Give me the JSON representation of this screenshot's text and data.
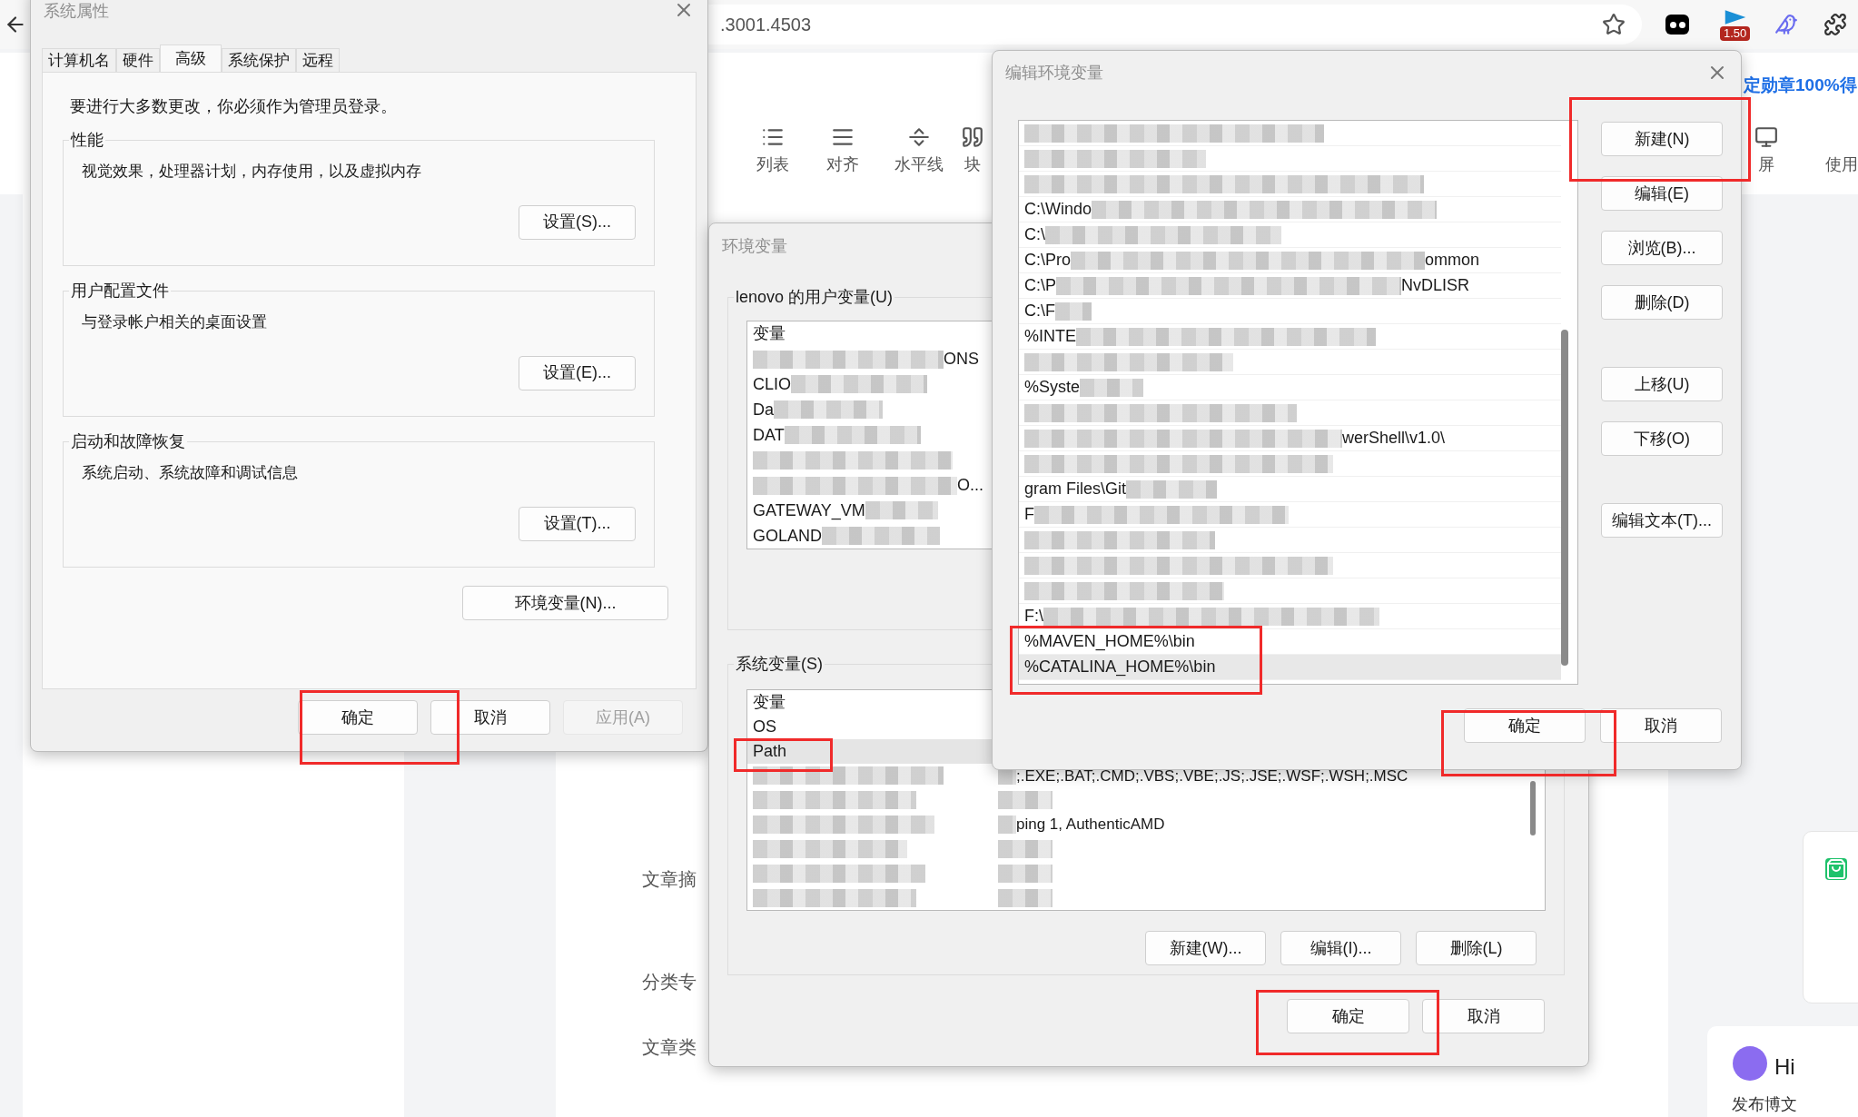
{
  "browser": {
    "address": ".3001.4503",
    "extension_badge": "1.50",
    "banner": "定勋章100%得"
  },
  "editor_toolbar": [
    {
      "label": "列表",
      "kind": "list"
    },
    {
      "label": "对齐",
      "kind": "align"
    },
    {
      "label": "水平线",
      "kind": "rule"
    },
    {
      "label": "块",
      "kind": "quote"
    },
    {
      "label": "屏",
      "kind": "screen"
    },
    {
      "label": "使用",
      "kind": "plain"
    }
  ],
  "form_labels": [
    "文章摘",
    "分类专",
    "文章类"
  ],
  "assistant": {
    "greeting": "Hi",
    "action": "发布博文"
  },
  "system_properties": {
    "title": "系统属性",
    "tabs": [
      {
        "label": "计算机名",
        "selected": false
      },
      {
        "label": "硬件",
        "selected": false
      },
      {
        "label": "高级",
        "selected": true
      },
      {
        "label": "系统保护",
        "selected": false
      },
      {
        "label": "远程",
        "selected": false
      }
    ],
    "notice": "要进行大多数更改，你必须作为管理员登录。",
    "groups": [
      {
        "title": "性能",
        "description": "视觉效果，处理器计划，内存使用，以及虚拟内存",
        "button": "设置(S)..."
      },
      {
        "title": "用户配置文件",
        "description": "与登录帐户相关的桌面设置",
        "button": "设置(E)..."
      },
      {
        "title": "启动和故障恢复",
        "description": "系统启动、系统故障和调试信息",
        "button": "设置(T)..."
      }
    ],
    "env_button": "环境变量(N)...",
    "buttons": [
      {
        "label": "确定",
        "disabled": false
      },
      {
        "label": "取消",
        "disabled": false
      },
      {
        "label": "应用(A)",
        "disabled": true
      }
    ]
  },
  "environment_variables": {
    "title": "环境变量",
    "user_group": "lenovo 的用户变量(U)",
    "user_header": "变量",
    "user_rows": [
      {
        "end": "ONS",
        "blurred": true
      },
      {
        "start": "CLIO",
        "blurred": true
      },
      {
        "start": "Da",
        "blurred": true
      },
      {
        "start": "DAT",
        "blurred": true
      },
      {
        "blurred": true
      },
      {
        "end": "O...",
        "blurred": true
      },
      {
        "start": "GATEWAY_VM",
        "blurred": true
      },
      {
        "start": "GOLAND",
        "blurred": true
      }
    ],
    "system_group": "系统变量(S)",
    "system_header": "变量",
    "system_rows": [
      {
        "name": "OS",
        "blurred": false,
        "selected": false
      },
      {
        "name": "Path",
        "blurred": false,
        "selected": true
      },
      {
        "value": ";.EXE;.BAT;.CMD;.VBS;.VBE;.JS;.JSE;.WSF;.WSH;.MSC",
        "blurred": true,
        "selected": false
      },
      {
        "blurred": true,
        "selected": false
      },
      {
        "value": "ping 1, AuthenticAMD",
        "blurred": true,
        "selected": false
      },
      {
        "blurred": true,
        "selected": false
      },
      {
        "blurred": true,
        "selected": false
      },
      {
        "blurred": true,
        "selected": false
      }
    ],
    "list_buttons": [
      "新建(W)...",
      "编辑(I)...",
      "删除(L)"
    ],
    "buttons": [
      "确定",
      "取消"
    ]
  },
  "edit_variable": {
    "title": "编辑环境变量",
    "rows": [
      {
        "blurred": true,
        "selected": false
      },
      {
        "blurred": true,
        "selected": false
      },
      {
        "blurred": true,
        "selected": false
      },
      {
        "start": "C:\\Windo",
        "blurred": true,
        "selected": false
      },
      {
        "start": "C:\\",
        "blurred": true,
        "selected": false
      },
      {
        "start": "C:\\Pro",
        "end": "ommon",
        "blurred": true,
        "selected": false
      },
      {
        "start": "C:\\P",
        "end": "NvDLISR",
        "blurred": true,
        "selected": false
      },
      {
        "start": "C:\\F",
        "blurred": true,
        "selected": false
      },
      {
        "start": "%INTE",
        "blurred": true,
        "selected": false
      },
      {
        "blurred": true,
        "selected": false
      },
      {
        "start": "%Syste",
        "blurred": true,
        "selected": false
      },
      {
        "blurred": true,
        "selected": false
      },
      {
        "end": "werShell\\v1.0\\",
        "blurred": true,
        "selected": false
      },
      {
        "blurred": true,
        "selected": false
      },
      {
        "start": "gram Files\\Git",
        "blurred": true,
        "selected": false
      },
      {
        "start": "F",
        "blurred": true,
        "selected": false
      },
      {
        "blurred": true,
        "selected": false
      },
      {
        "blurred": true,
        "selected": false
      },
      {
        "blurred": true,
        "selected": false
      },
      {
        "start": "F:\\",
        "blurred": true,
        "selected": false
      },
      {
        "start": "%MAVEN_HOME%\\bin",
        "blurred": false,
        "selected": false
      },
      {
        "start": "%CATALINA_HOME%\\bin",
        "blurred": false,
        "selected": true
      }
    ],
    "button_groups": [
      [
        "新建(N)",
        "编辑(E)",
        "浏览(B)...",
        "删除(D)"
      ],
      [
        "上移(U)",
        "下移(O)"
      ],
      [
        "编辑文本(T)..."
      ]
    ],
    "buttons": [
      "确定",
      "取消"
    ]
  }
}
